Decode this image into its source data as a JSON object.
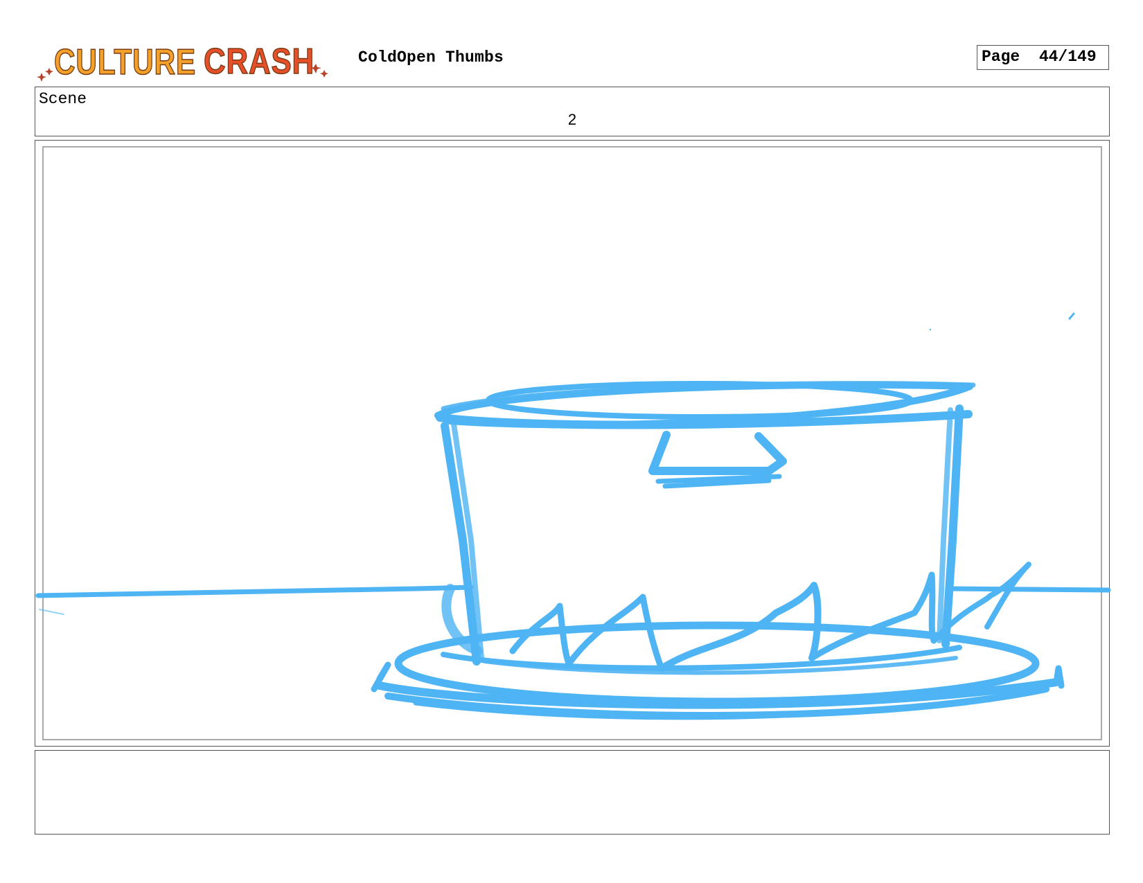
{
  "header": {
    "logo_text": "CULTURE CRASH",
    "logo_colors": {
      "culture": "#f2a12a",
      "crash": "#e5502a",
      "outline": "#7a3a12",
      "stars": "#b5442a"
    },
    "document_title": "ColdOpen Thumbs",
    "page_label": "Page  44/149"
  },
  "scene": {
    "label": "Scene",
    "number": "2"
  },
  "panel": {
    "sketch_color": "#4fb4f3",
    "sketch_subject": "cake-on-plate-drawing"
  },
  "notes": {
    "text": ""
  }
}
